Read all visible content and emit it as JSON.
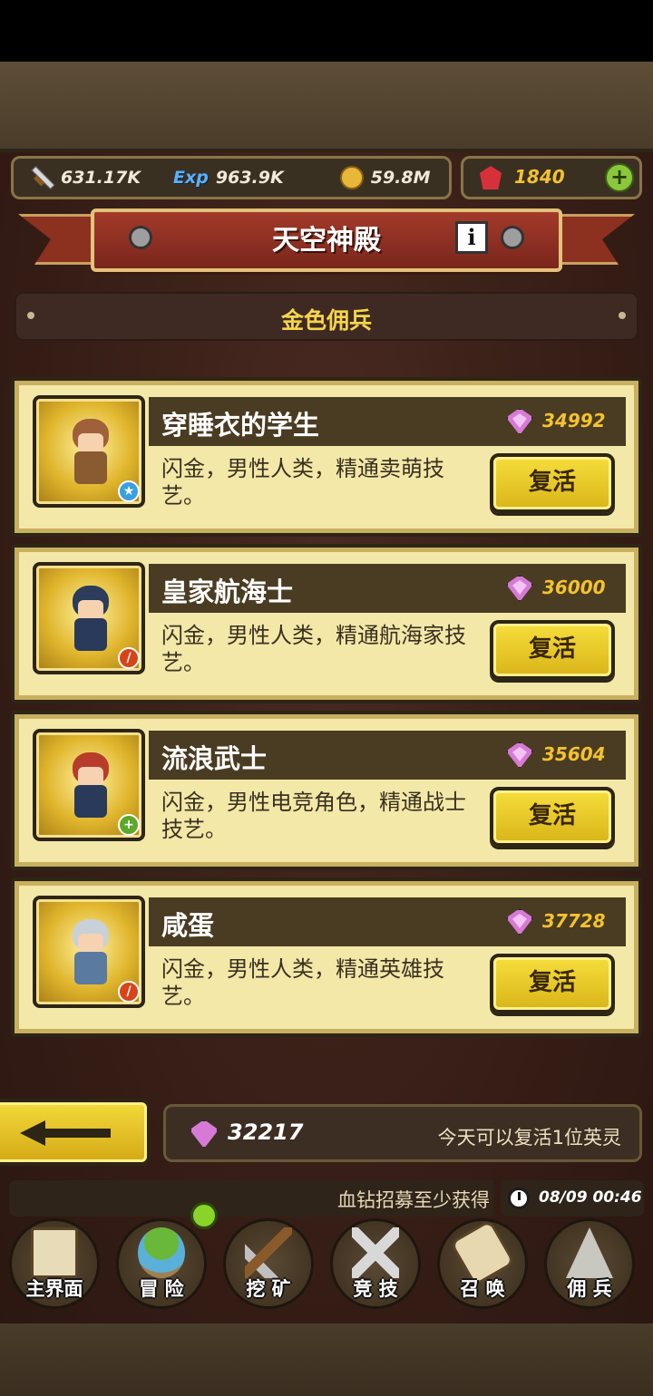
{
  "resources": {
    "attack": "631.17K",
    "exp_label": "Exp",
    "exp": "963.9K",
    "gold": "59.8M",
    "ruby": "1840"
  },
  "header": {
    "title": "天空神殿",
    "info_label": "i",
    "subtab": "金色佣兵"
  },
  "heroes": [
    {
      "name": "穿睡衣的学生",
      "price": "34992",
      "desc": "闪金，男性人类，精通卖萌技艺。",
      "revive_label": "复活",
      "badge": "★",
      "badge_color": "#3aa0e0",
      "hair": "#a0603a",
      "body": "#8a5a30"
    },
    {
      "name": "皇家航海士",
      "price": "36000",
      "desc": "闪金，男性人类，精通航海家技艺。",
      "revive_label": "复活",
      "badge": "/",
      "badge_color": "#d8441a",
      "hair": "#2c3c5a",
      "body": "#2a3a5a"
    },
    {
      "name": "流浪武士",
      "price": "35604",
      "desc": "闪金，男性电竞角色，精通战士技艺。",
      "revive_label": "复活",
      "badge": "+",
      "badge_color": "#5ca82a",
      "hair": "#b83c2c",
      "body": "#2a3a5a"
    },
    {
      "name": "咸蛋",
      "price": "37728",
      "desc": "闪金，男性人类，精通英雄技艺。",
      "revive_label": "复活",
      "badge": "/",
      "badge_color": "#d8441a",
      "hair": "#c8d0d8",
      "body": "#5a7aa0"
    }
  ],
  "footer": {
    "balance": "32217",
    "revive_note": "今天可以复活1位英灵",
    "ticker": "血钻招募至少获得",
    "clock": "08/09 00:46"
  },
  "nav": [
    {
      "label": "主界面",
      "icon": "map-scroll-icon"
    },
    {
      "label": "冒 险",
      "icon": "island-icon"
    },
    {
      "label": "挖 矿",
      "icon": "pickaxe-icon"
    },
    {
      "label": "竞 技",
      "icon": "crossed-swords-icon"
    },
    {
      "label": "召 唤",
      "icon": "summon-scroll-icon"
    },
    {
      "label": "佣 兵",
      "icon": "tent-icon"
    }
  ]
}
